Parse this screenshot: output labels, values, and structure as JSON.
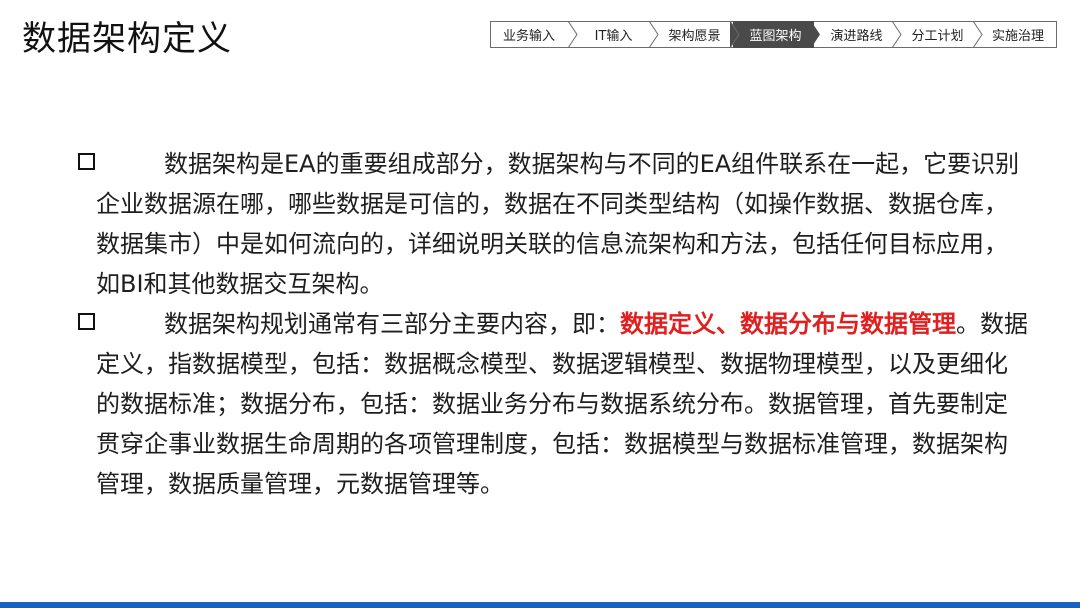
{
  "title": "数据架构定义",
  "nav": {
    "items": [
      {
        "label": "业务输入",
        "active": false
      },
      {
        "label": "IT输入",
        "active": false
      },
      {
        "label": "架构愿景",
        "active": false
      },
      {
        "label": "蓝图架构",
        "active": true
      },
      {
        "label": "演进路线",
        "active": false
      },
      {
        "label": "分工计划",
        "active": false
      },
      {
        "label": "实施治理",
        "active": false
      }
    ]
  },
  "content": {
    "para1": "数据架构是EA的重要组成部分，数据架构与不同的EA组件联系在一起，它要识别企业数据源在哪，哪些数据是可信的，数据在不同类型结构（如操作数据、数据仓库，数据集市）中是如何流向的，详细说明关联的信息流架构和方法，包括任何目标应用，如BI和其他数据交互架构。",
    "para2_lead": "数据架构规划通常有三部分主要内容，即：",
    "para2_highlight": "数据定义、数据分布与数据管理",
    "para2_rest": "。数据定义，指数据模型，包括：数据概念模型、数据逻辑模型、数据物理模型，以及更细化的数据标准；数据分布，包括：数据业务分布与数据系统分布。数据管理，首先要制定贯穿企事业数据生命周期的各项管理制度，包括：数据模型与数据标准管理，数据架构管理，数据质量管理，元数据管理等。"
  },
  "colors": {
    "highlight": "#e02020",
    "nav_active_bg": "#4a4a4a",
    "bottom_bar": "#1565c0"
  }
}
